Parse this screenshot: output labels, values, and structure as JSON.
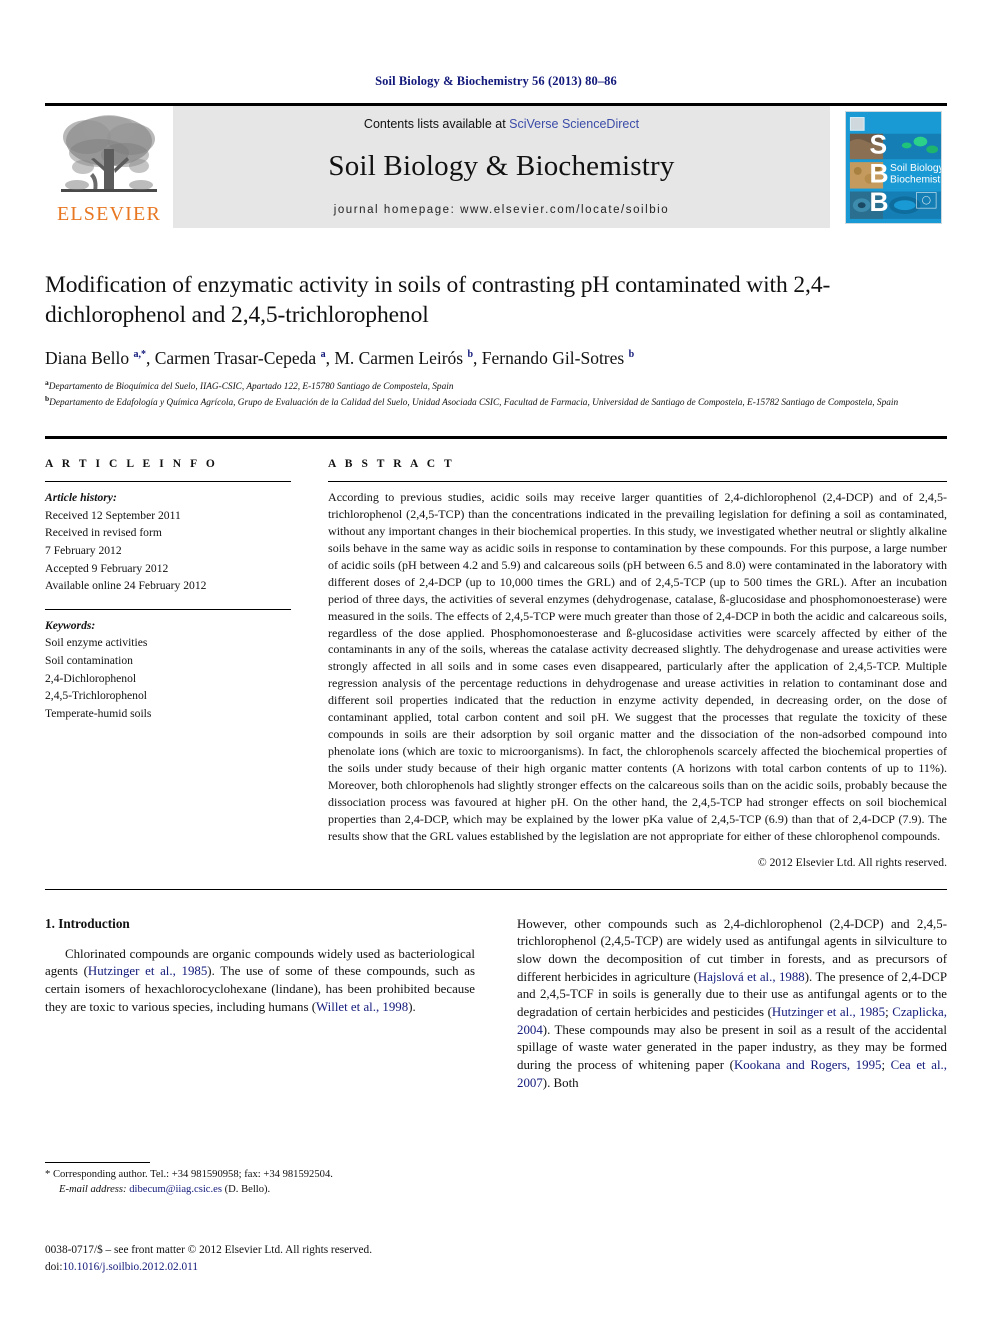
{
  "running_head": "Soil Biology & Biochemistry 56 (2013) 80–86",
  "masthead": {
    "publisher_name": "ELSEVIER",
    "contents_prefix": "Contents lists available at ",
    "contents_link": "SciVerse ScienceDirect",
    "journal_title": "Soil Biology & Biochemistry",
    "homepage": "journal homepage: www.elsevier.com/locate/soilbio",
    "cover": {
      "letters": [
        "S",
        "B",
        "B"
      ],
      "line1": "Soil Biology &",
      "line2": "Biochemistry"
    },
    "colors": {
      "link_blue": "#3b4ba8",
      "elsevier_orange": "#e87722",
      "band_gray": "#e6e6e6",
      "cover_blue": "#1a9ad4",
      "citation_blue": "#12197a"
    }
  },
  "article": {
    "title": "Modification of enzymatic activity in soils of contrasting pH contaminated with 2,4-dichlorophenol and 2,4,5-trichlorophenol",
    "authors_html": "Diana Bello <sup>a,*</sup>, Carmen Trasar-Cepeda <sup>a</sup>, M. Carmen Leirós <sup>b</sup>, Fernando Gil-Sotres <sup>b</sup>",
    "affiliation_a": "Departamento de Bioquímica del Suelo, IIAG-CSIC, Apartado 122, E-15780 Santiago de Compostela, Spain",
    "affiliation_b": "Departamento de Edafología y Química Agrícola, Grupo de Evaluación de la Calidad del Suelo, Unidad Asociada CSIC, Facultad de Farmacia, Universidad de Santiago de Compostela, E-15782 Santiago de Compostela, Spain"
  },
  "article_info": {
    "heading": "A R T I C L E   I N F O",
    "history_label": "Article history:",
    "history": [
      "Received 12 September 2011",
      "Received in revised form",
      "7 February 2012",
      "Accepted 9 February 2012",
      "Available online 24 February 2012"
    ],
    "keywords_label": "Keywords:",
    "keywords": [
      "Soil enzyme activities",
      "Soil contamination",
      "2,4-Dichlorophenol",
      "2,4,5-Trichlorophenol",
      "Temperate-humid soils"
    ]
  },
  "abstract": {
    "heading": "A B S T R A C T",
    "text": "According to previous studies, acidic soils may receive larger quantities of 2,4-dichlorophenol (2,4-DCP) and of 2,4,5-trichlorophenol (2,4,5-TCP) than the concentrations indicated in the prevailing legislation for defining a soil as contaminated, without any important changes in their biochemical properties. In this study, we investigated whether neutral or slightly alkaline soils behave in the same way as acidic soils in response to contamination by these compounds. For this purpose, a large number of acidic soils (pH between 4.2 and 5.9) and calcareous soils (pH between 6.5 and 8.0) were contaminated in the laboratory with different doses of 2,4-DCP (up to 10,000 times the GRL) and of 2,4,5-TCP (up to 500 times the GRL). After an incubation period of three days, the activities of several enzymes (dehydrogenase, catalase, ß-glucosidase and phosphomonoesterase) were measured in the soils. The effects of 2,4,5-TCP were much greater than those of 2,4-DCP in both the acidic and calcareous soils, regardless of the dose applied. Phosphomonoesterase and ß-glucosidase activities were scarcely affected by either of the contaminants in any of the soils, whereas the catalase activity decreased slightly. The dehydrogenase and urease activities were strongly affected in all soils and in some cases even disappeared, particularly after the application of 2,4,5-TCP. Multiple regression analysis of the percentage reductions in dehydrogenase and urease activities in relation to contaminant dose and different soil properties indicated that the reduction in enzyme activity depended, in decreasing order, on the dose of contaminant applied, total carbon content and soil pH. We suggest that the processes that regulate the toxicity of these compounds in soils are their adsorption by soil organic matter and the dissociation of the non-adsorbed compound into phenolate ions (which are toxic to microorganisms). In fact, the chlorophenols scarcely affected the biochemical properties of the soils under study because of their high organic matter contents (A horizons with total carbon contents of up to 11%). Moreover, both chlorophenols had slightly stronger effects on the calcareous soils than on the acidic soils, probably because the dissociation process was favoured at higher pH. On the other hand, the 2,4,5-TCP had stronger effects on soil biochemical properties than 2,4-DCP, which may be explained by the lower pKa value of 2,4,5-TCP (6.9) than that of 2,4-DCP (7.9). The results show that the GRL values established by the legislation are not appropriate for either of these chlorophenol compounds.",
    "copyright": "© 2012 Elsevier Ltd. All rights reserved."
  },
  "introduction": {
    "heading": "1. Introduction",
    "left_paragraph_html": "Chlorinated compounds are organic compounds widely used as bacteriological agents (<span class=\"cite\">Hutzinger et al., 1985</span>). The use of some of these compounds, such as certain isomers of hexachlorocyclohexane (lindane), has been prohibited because they are toxic to various species, including humans (<span class=\"cite\">Willet et al., 1998</span>).",
    "right_paragraph_html": "However, other compounds such as 2,4-dichlorophenol (2,4-DCP) and 2,4,5-trichlorophenol (2,4,5-TCP) are widely used as antifungal agents in silviculture to slow down the decomposition of cut timber in forests, and as precursors of different herbicides in agriculture (<span class=\"cite\">Hajslová et al., 1988</span>). The presence of 2,4-DCP and 2,4,5-TCF in soils is generally due to their use as antifungal agents or to the degradation of certain herbicides and pesticides (<span class=\"cite\">Hutzinger et al., 1985</span>; <span class=\"cite\">Czaplicka, 2004</span>). These compounds may also be present in soil as a result of the accidental spillage of waste water generated in the paper industry, as they may be formed during the process of whitening paper (<span class=\"cite\">Kookana and Rogers, 1995</span>; <span class=\"cite\">Cea et al., 2007</span>). Both"
  },
  "footnotes": {
    "corresponding_html": "* Corresponding author. Tel.: +34 981590958; fax: +34 981592504.",
    "email_html": "<span class=\"ital\">E-mail address:</span> <span class=\"mail\">dibecum@iiag.csic.es</span> (D. Bello)."
  },
  "imprint": {
    "line1": "0038-0717/$ – see front matter © 2012 Elsevier Ltd. All rights reserved.",
    "doi_prefix": "doi:",
    "doi_value": "10.1016/j.soilbio.2012.02.011"
  }
}
